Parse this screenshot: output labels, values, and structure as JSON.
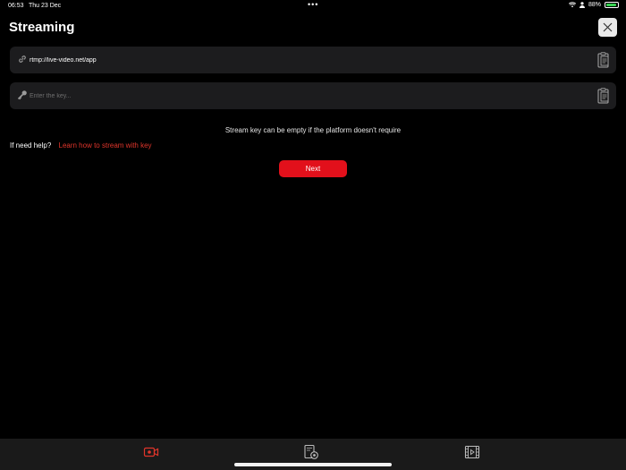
{
  "status_bar": {
    "time": "06:53",
    "date": "Thu 23 Dec",
    "dots": "•••",
    "battery_percent": "88%",
    "battery_level": 0.88
  },
  "header": {
    "title": "Streaming"
  },
  "form": {
    "url_value": "rtmp://live-video.net/app",
    "key_value": "",
    "key_placeholder": "Enter the key...",
    "hint": "Stream key can be empty if the platform doesn't require",
    "help_label": "If need help?",
    "help_link": "Learn how to stream with key",
    "next_label": "Next"
  },
  "tab_bar": {
    "items": [
      {
        "icon": "record-icon",
        "active": true
      },
      {
        "icon": "gallery-icon",
        "active": false
      },
      {
        "icon": "film-icon",
        "active": false
      }
    ]
  },
  "colors": {
    "accent": "#e2101b",
    "link": "#e0352b",
    "field_bg": "#1c1c1e",
    "tab_bar_bg": "#1a1a1a"
  }
}
